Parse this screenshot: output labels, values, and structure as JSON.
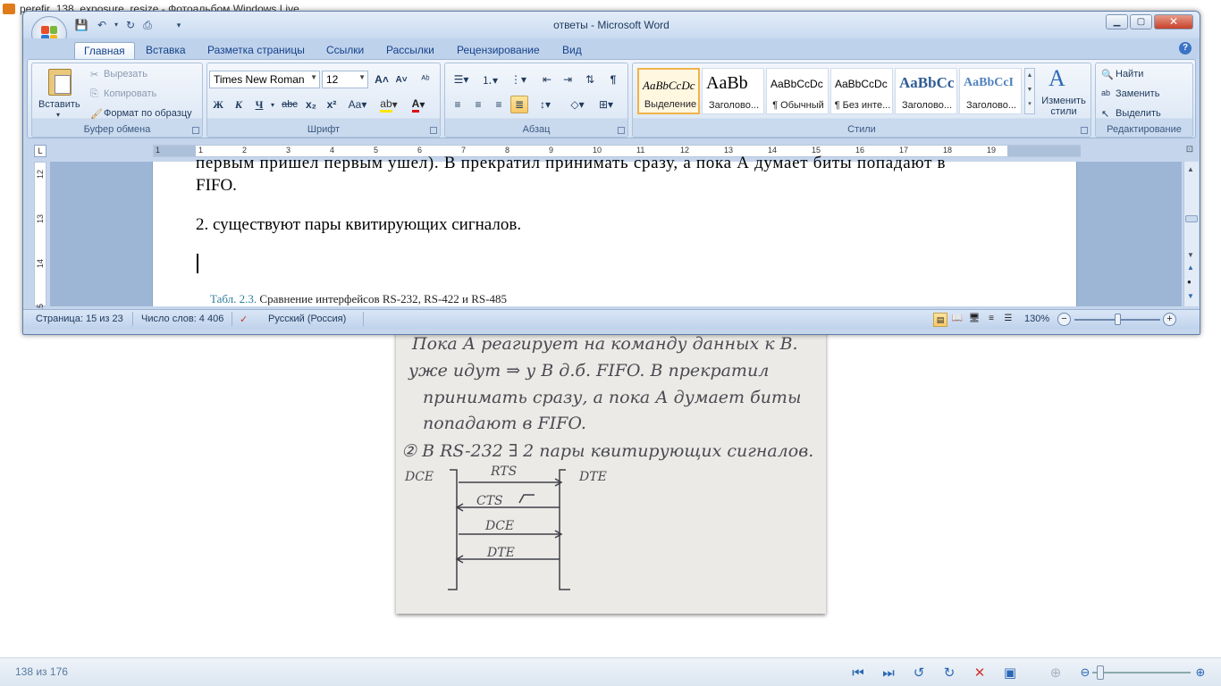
{
  "photo_viewer": {
    "title": "perefir_138_exposure_resize - Фотоальбом Windows Live",
    "counter": "138 из 176",
    "buttons": [
      "previous-icon",
      "next-icon",
      "rotate-left-icon",
      "rotate-right-icon",
      "delete-icon",
      "slideshow-icon",
      "fit-icon",
      "zoom-out-icon",
      "zoom-in-icon"
    ]
  },
  "word": {
    "title": "ответы - Microsoft Word",
    "tabs": [
      {
        "label": "Главная",
        "active": true
      },
      {
        "label": "Вставка"
      },
      {
        "label": "Разметка страницы"
      },
      {
        "label": "Ссылки"
      },
      {
        "label": "Рассылки"
      },
      {
        "label": "Рецензирование"
      },
      {
        "label": "Вид"
      }
    ],
    "clipboard": {
      "paste": "Вставить",
      "cut": "Вырезать",
      "copy": "Копировать",
      "format_painter": "Формат по образцу",
      "group": "Буфер обмена"
    },
    "font": {
      "name": "Times New Roman",
      "size": "12",
      "group": "Шрифт"
    },
    "paragraph": {
      "group": "Абзац"
    },
    "styles": {
      "items": [
        {
          "sample": "AaBbCcDc",
          "name": "Выделение"
        },
        {
          "sample": "AaBb",
          "name": "Заголово..."
        },
        {
          "sample": "AaBbCcDc",
          "name": "¶ Обычный"
        },
        {
          "sample": "AaBbCcDc",
          "name": "¶ Без инте..."
        },
        {
          "sample": "AaBbCc",
          "name": "Заголово..."
        },
        {
          "sample": "AaBbCcI",
          "name": "Заголово..."
        }
      ],
      "change": "Изменить стили",
      "group": "Стили"
    },
    "editing": {
      "find": "Найти",
      "replace": "Заменить",
      "select": "Выделить",
      "group": "Редактирование"
    },
    "document": {
      "line1": "первым пришел первым ушел). В прекратил принимать сразу, а пока А думает биты попадают в",
      "line2": "FIFO.",
      "line3": "2. существуют пары квитирующих сигналов.",
      "caption_prefix": "Табл. 2.3.",
      "caption": " Сравнение интерфейсов RS-232, RS-422 и RS-485"
    },
    "status": {
      "page": "Страница: 15 из 23",
      "words": "Число слов: 4 406",
      "language": "Русский (Россия)",
      "zoom": "130%"
    },
    "ruler": {
      "numbers": [
        "1",
        "1",
        "2",
        "3",
        "4",
        "5",
        "6",
        "7",
        "8",
        "9",
        "10",
        "11",
        "12",
        "13",
        "14",
        "15",
        "16",
        "17",
        "18",
        "19"
      ],
      "vnumbers": [
        "12",
        "13",
        "14",
        "15"
      ]
    }
  },
  "handwritten_note": {
    "lines": [
      "Пока А реагирует на команду данных к В.",
      "уже идут ⇒ у В д.б. FIFO. В прекратил",
      "принимать сразу, а пока А думает биты",
      "попадают в FIFO.",
      "② В RS-232 ∃ 2 пары квитирующих сигналов."
    ],
    "labels": {
      "left": "DCE",
      "right": "DTE",
      "s1": "RTS",
      "s2": "CTS",
      "s3": "DCE",
      "s4": "DTE"
    }
  }
}
